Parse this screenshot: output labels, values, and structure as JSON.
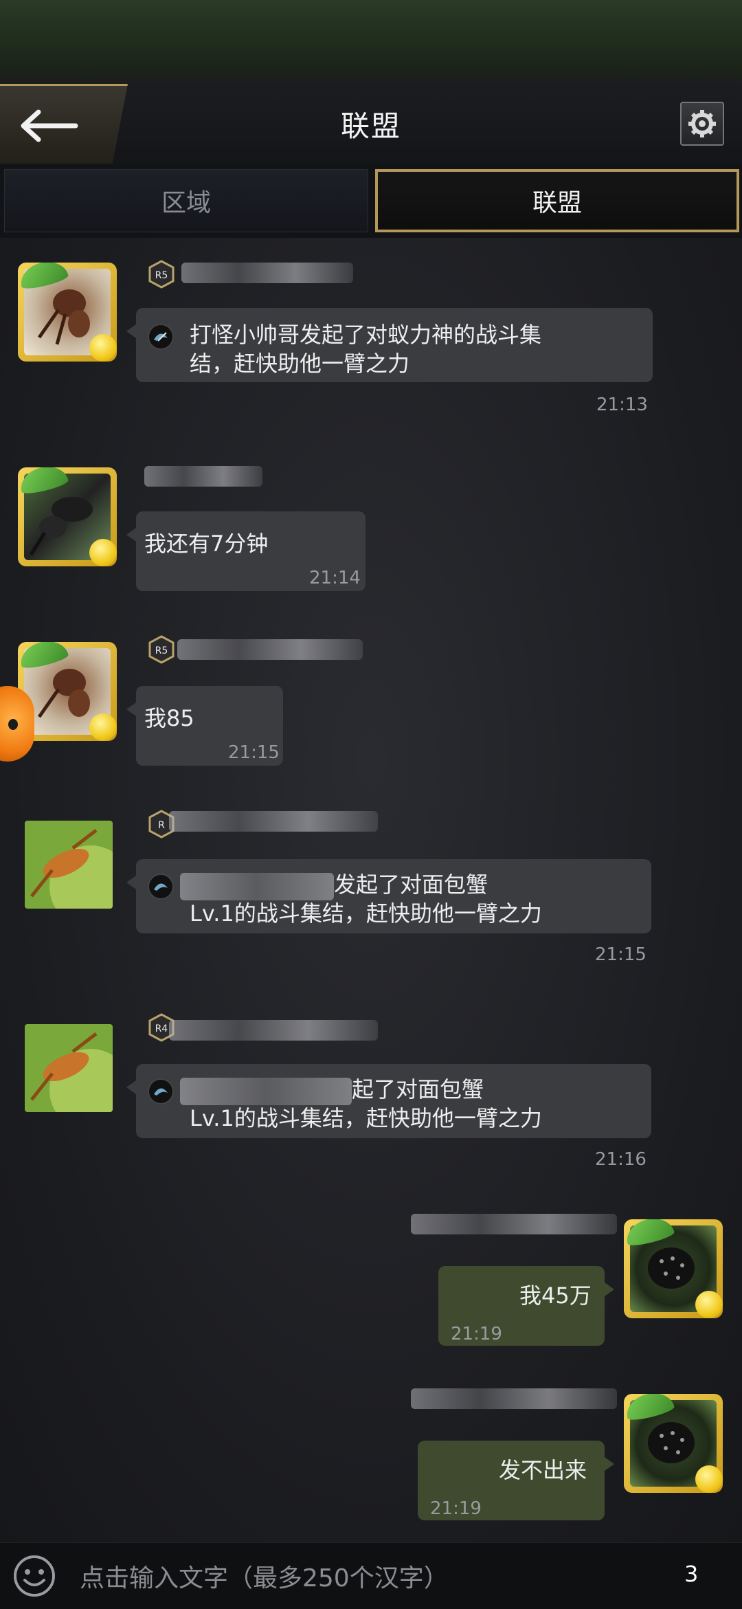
{
  "header": {
    "title": "联盟",
    "back_icon": "arrow-left-icon",
    "settings_icon": "gear-icon"
  },
  "tabs": [
    {
      "label": "区域",
      "active": false
    },
    {
      "label": "联盟",
      "active": true
    }
  ],
  "messages": [
    {
      "side": "left",
      "badge": "R5",
      "text_line1": "打怪小帅哥发起了对蚁力神的战斗集",
      "text_line2": "结，赶快助他一臂之力",
      "time": "21:13",
      "type": "rally"
    },
    {
      "side": "left",
      "badge": "",
      "text": "我还有7分钟",
      "time": "21:14",
      "type": "text"
    },
    {
      "side": "left",
      "badge": "R5",
      "text": "我85",
      "time": "21:15",
      "type": "text"
    },
    {
      "side": "left",
      "badge": "R",
      "text_line1": "发起了对面包蟹",
      "text_line2": "Lv.1的战斗集结，赶快助他一臂之力",
      "time": "21:15",
      "type": "rally"
    },
    {
      "side": "left",
      "badge": "R4",
      "text_line1": "起了对面包蟹",
      "text_line2": "Lv.1的战斗集结，赶快助他一臂之力",
      "time": "21:16",
      "type": "rally"
    },
    {
      "side": "right",
      "badge": "",
      "text": "我45万",
      "time": "21:19",
      "type": "text"
    },
    {
      "side": "right",
      "badge": "",
      "text": "发不出来",
      "time": "21:19",
      "type": "text"
    }
  ],
  "input": {
    "placeholder": "点击输入文字（最多250个汉字）",
    "emoji_icon": "smiley-icon",
    "count": "3"
  },
  "colors": {
    "accent_gold": "#b3985a",
    "bubble_other": "#3b3c40",
    "bubble_mine": "#3f4a2e"
  }
}
